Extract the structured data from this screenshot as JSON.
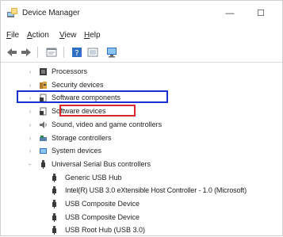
{
  "window": {
    "title": "Device Manager",
    "minimize_glyph": "—",
    "maximize_glyph": "☐"
  },
  "menu": {
    "file": "File",
    "action": "Action",
    "view": "View",
    "help": "Help"
  },
  "toolbar": {
    "buttons": [
      "back-icon",
      "forward-icon",
      "properties-icon",
      "help-icon",
      "update-icon",
      "monitor-icon"
    ]
  },
  "tree": {
    "categories": [
      {
        "label": "Processors",
        "icon": "processor-icon",
        "expanded": false
      },
      {
        "label": "Security devices",
        "icon": "security-device-icon",
        "expanded": false
      },
      {
        "label": "Software components",
        "icon": "software-component-icon",
        "expanded": false
      },
      {
        "label": "Software devices",
        "icon": "software-device-icon",
        "expanded": false
      },
      {
        "label": "Sound, video and game controllers",
        "icon": "sound-icon",
        "expanded": false
      },
      {
        "label": "Storage controllers",
        "icon": "storage-icon",
        "expanded": false
      },
      {
        "label": "System devices",
        "icon": "system-device-icon",
        "expanded": false
      },
      {
        "label": "Universal Serial Bus controllers",
        "icon": "usb-icon",
        "expanded": true
      }
    ],
    "usb_children": [
      "Generic USB Hub",
      "Intel(R) USB 3.0 eXtensible Host Controller - 1.0 (Microsoft)",
      "USB Composite Device",
      "USB Composite Device",
      "USB Root Hub (USB 3.0)"
    ]
  },
  "highlights": {
    "blue": "#1a30d4",
    "red": "#d8262c"
  }
}
